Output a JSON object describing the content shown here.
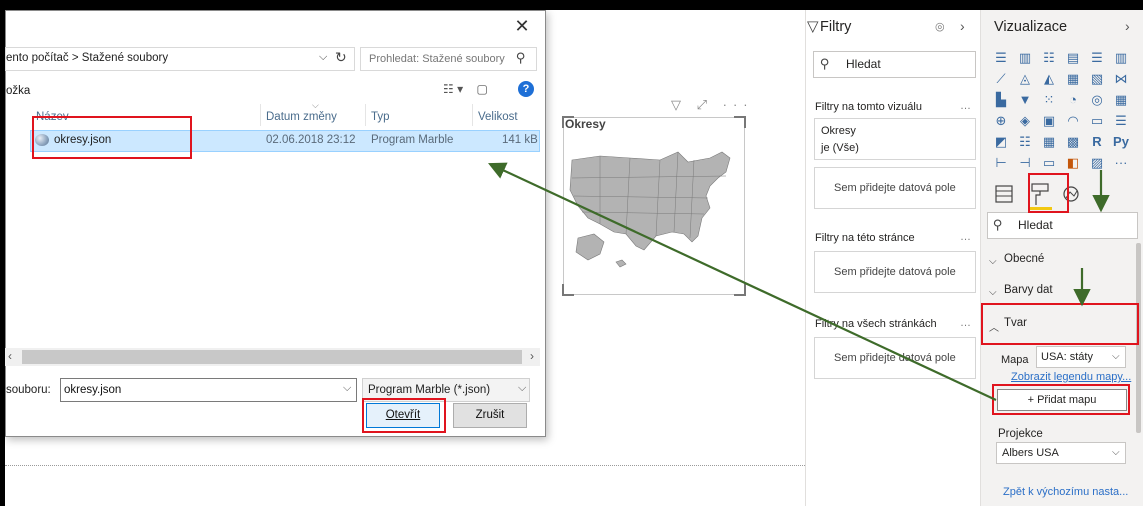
{
  "dialog": {
    "close": "✕",
    "breadcrumb": "ento počítač  >  Stažené soubory",
    "search_placeholder": "Prohledat: Stažené soubory",
    "folder_label": "ožka",
    "columns": [
      "Název",
      "Datum změny",
      "Typ",
      "Velikost"
    ],
    "file": {
      "name": "okresy.json",
      "date": "02.06.2018 23:12",
      "type": "Program Marble",
      "size": "141 kB"
    },
    "filename_label": "souboru:",
    "filename_value": "okresy.json",
    "filetype_value": "Program Marble (*.json)",
    "open_label": "Otevřít",
    "cancel_label": "Zrušit"
  },
  "visual": {
    "title": "Okresy",
    "toolbar": "▽ ⤢ ···"
  },
  "filters": {
    "title": "Filtry",
    "search": "Hledat",
    "section_visual": "Filtry na tomto vizuálu",
    "filter_card_line1": "Okresy",
    "filter_card_line2": "je (Vše)",
    "drop_here": "Sem přidejte datová pole",
    "section_page": "Filtry na této stránce",
    "section_all": "Filtry na všech stránkách"
  },
  "visualizations": {
    "title": "Vizualizace",
    "search": "Hledat",
    "sections": [
      "Obecné",
      "Barvy dat",
      "Tvar"
    ],
    "map_label": "Mapa",
    "map_value": "USA: státy",
    "legend_link": "Zobrazit legendu mapy...",
    "add_map": "+ Přidat mapu",
    "projection_label": "Projekce",
    "projection_value": "Albers USA",
    "reset_link": "Zpět k výchozímu nasta..."
  },
  "colors": {
    "highlight_red": "#e0141e",
    "arrow_green": "#3e6b2a",
    "accent_blue": "#0078d7",
    "selection_blue": "#cce8ff"
  }
}
